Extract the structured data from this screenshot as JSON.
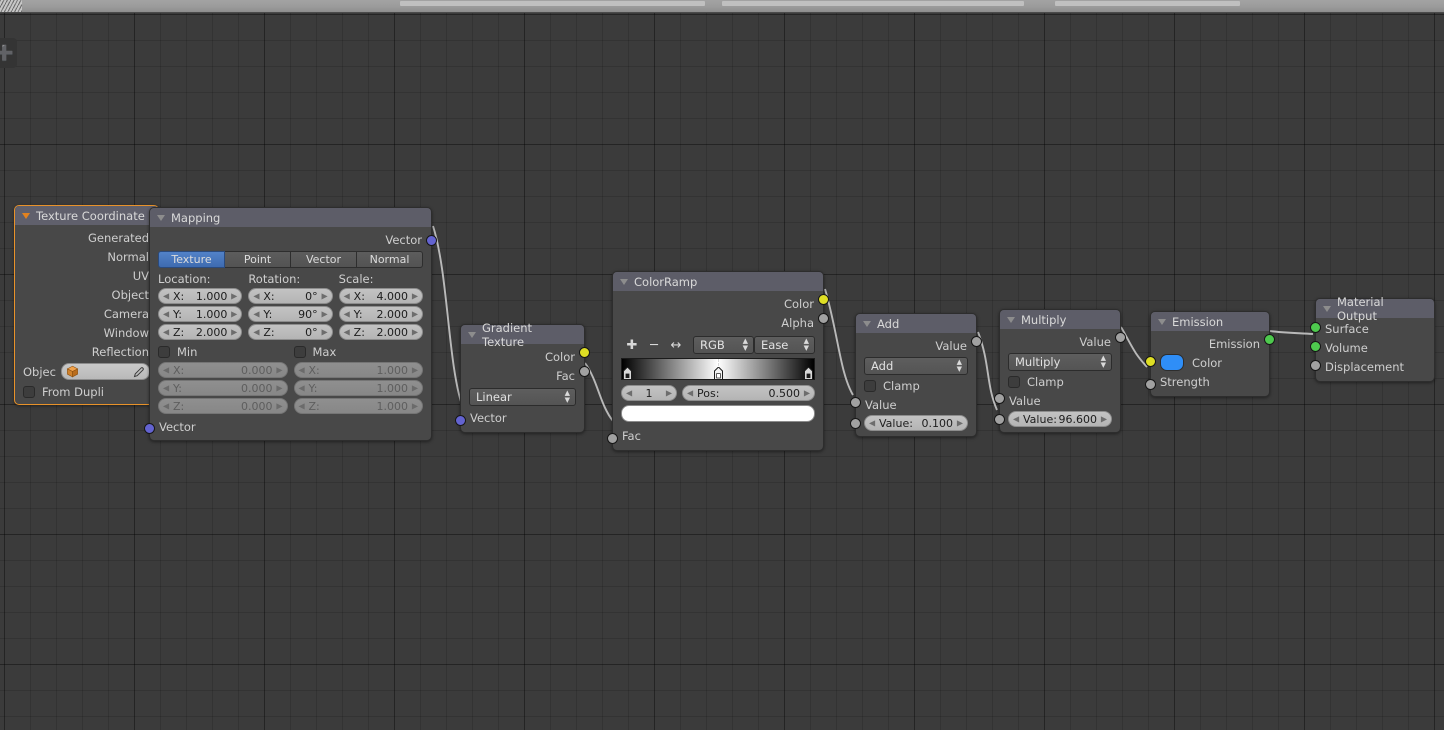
{
  "app": {
    "editor": "blender-node-editor",
    "topbar_segments": 4
  },
  "canvas": {
    "toolshelf_tab_icon": "plus-icon",
    "background_color": "#3b3b3b",
    "grid_color": "#313131"
  },
  "colors": {
    "socket_vector": "#6363d0",
    "socket_value": "#a1a1a1",
    "socket_color": "#dede24",
    "socket_shader": "#4ec94e",
    "node_header": "#5d5d68",
    "node_body": "#484848",
    "selected_outline": "#e8922a",
    "emission_color_swatch": "#2f8ef7",
    "active_tab": "#4772b3",
    "wire": "#b9b9b9"
  },
  "nodes": [
    {
      "id": "texture-coordinate",
      "title": "Texture Coordinate",
      "selected": true,
      "outputs": [
        "Generated",
        "Normal",
        "UV",
        "Object",
        "Camera",
        "Window",
        "Reflection"
      ],
      "object_label": "Objec",
      "object_icon": "cube-icon",
      "eyedropper_icon": "eyedropper-icon",
      "from_dupli_label": "From Dupli",
      "from_dupli_checked": false
    },
    {
      "id": "mapping",
      "title": "Mapping",
      "output_label": "Vector",
      "input_label": "Vector",
      "tabs": [
        "Texture",
        "Point",
        "Vector",
        "Normal"
      ],
      "active_tab": "Texture",
      "groups": [
        {
          "caption": "Location:",
          "fields": [
            {
              "label": "X:",
              "value": "1.000"
            },
            {
              "label": "Y:",
              "value": "1.000"
            },
            {
              "label": "Z:",
              "value": "2.000"
            }
          ]
        },
        {
          "caption": "Rotation:",
          "fields": [
            {
              "label": "X:",
              "value": "0°"
            },
            {
              "label": "Y:",
              "value": "90°"
            },
            {
              "label": "Z:",
              "value": "0°"
            }
          ]
        },
        {
          "caption": "Scale:",
          "fields": [
            {
              "label": "X:",
              "value": "4.000"
            },
            {
              "label": "Y:",
              "value": "2.000"
            },
            {
              "label": "Z:",
              "value": "2.000"
            }
          ]
        }
      ],
      "min": {
        "label": "Min",
        "checked": false,
        "fields": [
          {
            "label": "X:",
            "value": "0.000"
          },
          {
            "label": "Y:",
            "value": "0.000"
          },
          {
            "label": "Z:",
            "value": "0.000"
          }
        ]
      },
      "max": {
        "label": "Max",
        "checked": false,
        "fields": [
          {
            "label": "X:",
            "value": "1.000"
          },
          {
            "label": "Y:",
            "value": "1.000"
          },
          {
            "label": "Z:",
            "value": "1.000"
          }
        ]
      }
    },
    {
      "id": "gradient-texture",
      "title": "Gradient Texture",
      "outputs": [
        "Color",
        "Fac"
      ],
      "type_value": "Linear",
      "input_label": "Vector"
    },
    {
      "id": "colorramp",
      "title": "ColorRamp",
      "outputs": [
        "Color",
        "Alpha"
      ],
      "tool_icons": [
        "plus-icon",
        "minus-icon",
        "flip-icon"
      ],
      "color_mode": "RGB",
      "interpolation": "Ease",
      "stop_index": "1",
      "pos_label": "Pos:",
      "pos_value": "0.500",
      "stop_color": "#ffffff",
      "gradient_stops": [
        {
          "position": 0.0,
          "color": "#000000"
        },
        {
          "position": 0.5,
          "color": "#ffffff"
        },
        {
          "position": 1.0,
          "color": "#000000"
        }
      ],
      "input_label": "Fac"
    },
    {
      "id": "math-add",
      "title": "Add",
      "output_label": "Value",
      "operation": "Add",
      "clamp_label": "Clamp",
      "clamp_checked": false,
      "input_label": "Value",
      "value_label": "Value:",
      "value": "0.100"
    },
    {
      "id": "math-multiply",
      "title": "Multiply",
      "output_label": "Value",
      "operation": "Multiply",
      "clamp_label": "Clamp",
      "clamp_checked": false,
      "input_label": "Value",
      "value_label": "Value:",
      "value": "96.600"
    },
    {
      "id": "emission",
      "title": "Emission",
      "output_label": "Emission",
      "color_label": "Color",
      "strength_label": "Strength"
    },
    {
      "id": "material-output",
      "title": "Material Output",
      "inputs": [
        "Surface",
        "Volume",
        "Displacement"
      ]
    }
  ],
  "connections": [
    {
      "from": "texture-coordinate.Object",
      "to": "mapping.Vector"
    },
    {
      "from": "mapping.Vector",
      "to": "gradient-texture.Vector"
    },
    {
      "from": "gradient-texture.Fac",
      "to": "colorramp.Fac"
    },
    {
      "from": "colorramp.Color",
      "to": "math-add.Value"
    },
    {
      "from": "math-add.Value",
      "to": "math-multiply.Value"
    },
    {
      "from": "math-multiply.Value",
      "to": "emission.Strength"
    },
    {
      "from": "emission.Emission",
      "to": "material-output.Volume"
    }
  ]
}
